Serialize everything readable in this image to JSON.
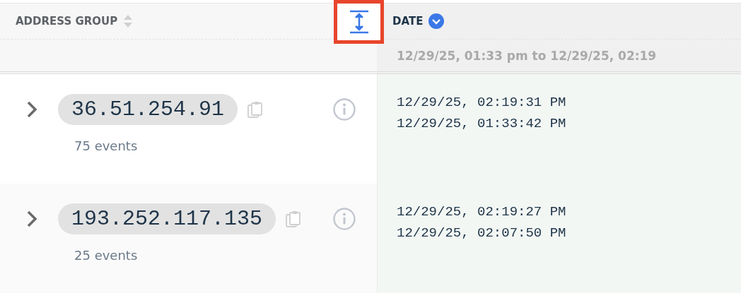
{
  "columns": [
    {
      "label": "ADDRESS GROUP",
      "sorted": false
    },
    {
      "label": "DATE",
      "sorted": true
    }
  ],
  "date_filter": "12/29/25, 01:33 pm to 12/29/25, 02:19",
  "row_height_button": {
    "selected": true
  },
  "rows": [
    {
      "address": "36.51.254.91",
      "events": "75 events",
      "expanded": false,
      "dates": [
        "12/29/25, 02:19:31 PM",
        "12/29/25, 01:33:42 PM"
      ]
    },
    {
      "address": "193.252.117.135",
      "events": "25 events",
      "expanded": false,
      "dates": [
        "12/29/25, 02:19:27 PM",
        "12/29/25, 02:07:50 PM"
      ]
    }
  ]
}
